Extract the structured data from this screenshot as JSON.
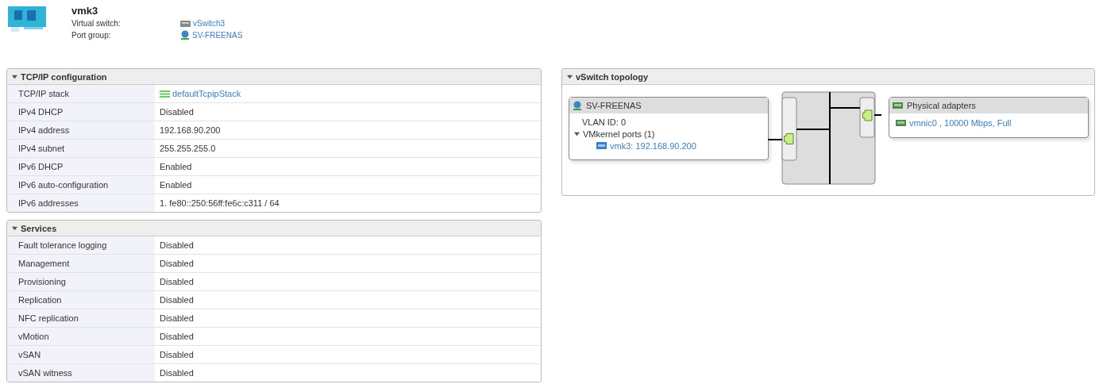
{
  "header": {
    "title": "vmk3",
    "fields": [
      {
        "label": "Virtual switch:",
        "value": "vSwitch3",
        "kind": "switch"
      },
      {
        "label": "Port group:",
        "value": "SV-FREENAS",
        "kind": "portgroup"
      }
    ]
  },
  "sections": [
    {
      "title": "TCP/IP configuration",
      "expanded": true,
      "rows": [
        {
          "label": "TCP/IP stack",
          "value": "defaultTcpipStack",
          "kind": "link"
        },
        {
          "label": "IPv4 DHCP",
          "value": "Disabled",
          "kind": "text"
        },
        {
          "label": "IPv4 address",
          "value": "192.168.90.200",
          "kind": "text"
        },
        {
          "label": "IPv4 subnet",
          "value": "255.255.255.0",
          "kind": "text"
        },
        {
          "label": "IPv6 DHCP",
          "value": "Enabled",
          "kind": "text"
        },
        {
          "label": "IPv6 auto-configuration",
          "value": "Enabled",
          "kind": "text"
        },
        {
          "label": "IPv6 addresses",
          "value": "1. fe80::250:56ff:fe6c:c311 / 64",
          "kind": "text"
        }
      ]
    },
    {
      "title": "Services",
      "expanded": true,
      "rows": [
        {
          "label": "Fault tolerance logging",
          "value": "Disabled",
          "kind": "text"
        },
        {
          "label": "Management",
          "value": "Disabled",
          "kind": "text"
        },
        {
          "label": "Provisioning",
          "value": "Disabled",
          "kind": "text"
        },
        {
          "label": "Replication",
          "value": "Disabled",
          "kind": "text"
        },
        {
          "label": "NFC replication",
          "value": "Disabled",
          "kind": "text"
        },
        {
          "label": "vMotion",
          "value": "Disabled",
          "kind": "text"
        },
        {
          "label": "vSAN",
          "value": "Disabled",
          "kind": "text"
        },
        {
          "label": "vSAN witness",
          "value": "Disabled",
          "kind": "text"
        }
      ]
    }
  ],
  "topology": {
    "title": "vSwitch topology",
    "expanded": true,
    "port_group": {
      "name": "SV-FREENAS",
      "vlan": "VLAN ID: 0",
      "ports_label": "VMkernel ports (1)",
      "ports_expanded": true,
      "ports": [
        "vmk3: 192.168.90.200"
      ]
    },
    "adapters": {
      "title": "Physical adapters",
      "items": [
        "vmnic0 , 10000 Mbps, Full"
      ]
    }
  }
}
